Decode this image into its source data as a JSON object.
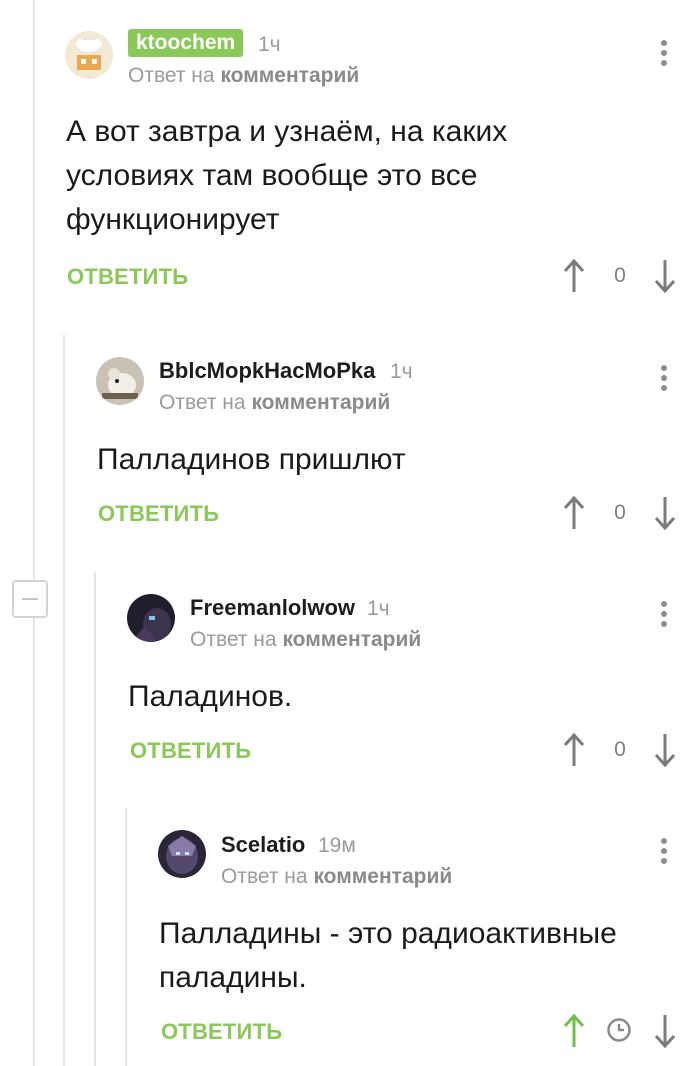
{
  "comments": [
    {
      "author": "ktoochem",
      "time": "1ч",
      "reply_prefix": "Ответ на",
      "reply_target": "комментарий",
      "text": "А вот завтра и узнаём, на каких условиях там вообще это все функционирует",
      "reply_label": "ОТВЕТИТЬ",
      "score": "0",
      "author_badge_color": "#8ac858"
    },
    {
      "author": "BblcMopkHacMoPka",
      "time": "1ч",
      "reply_prefix": "Ответ на",
      "reply_target": "комментарий",
      "text": "Палладинов пришлют",
      "reply_label": "ОТВЕТИТЬ",
      "score": "0"
    },
    {
      "author": "Freemanlolwow",
      "time": "1ч",
      "reply_prefix": "Ответ на",
      "reply_target": "комментарий",
      "text": "Паладинов.",
      "reply_label": "ОТВЕТИТЬ",
      "score": "0"
    },
    {
      "author": "Scelatio",
      "time": "19м",
      "reply_prefix": "Ответ на",
      "reply_target": "комментарий",
      "text": "Палладины - это радиоактивные паладины.",
      "reply_label": "ОТВЕТИТЬ",
      "score_state": "pending-clock-icon",
      "upvoted": true
    }
  ],
  "colors": {
    "accent": "#8ac858",
    "muted": "#9a9a9a",
    "thread_line": "#e4e4e4"
  }
}
